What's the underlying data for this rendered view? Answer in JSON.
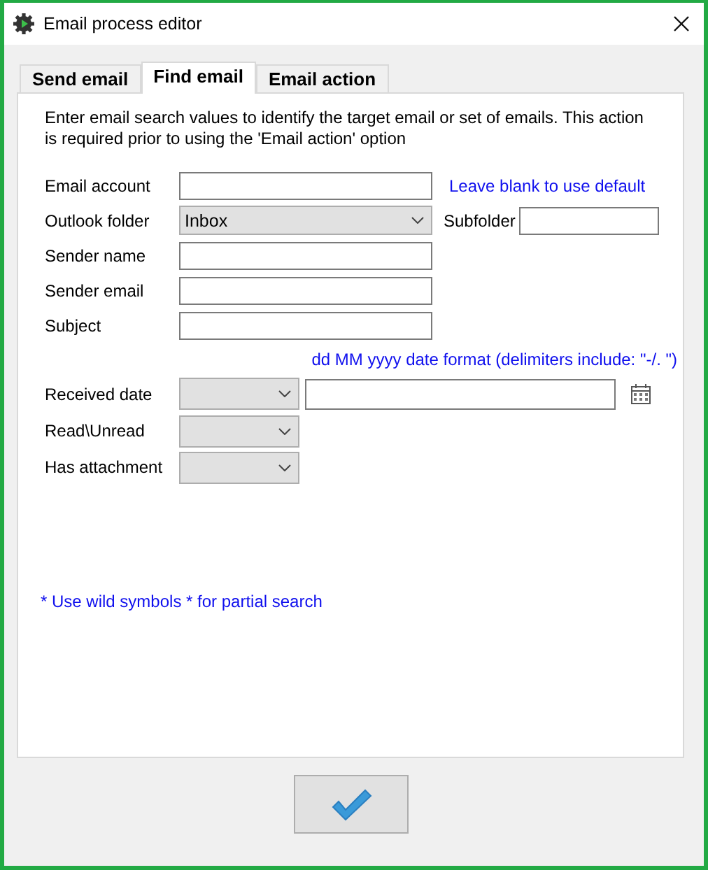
{
  "window": {
    "title": "Email process editor"
  },
  "tabs": [
    {
      "label": "Send email",
      "selected": false
    },
    {
      "label": "Find email",
      "selected": true
    },
    {
      "label": "Email action",
      "selected": false
    }
  ],
  "description": "Enter email search values to identify the target email or set of emails. This action is required prior to using the 'Email action' option",
  "fields": [
    {
      "kind": "text",
      "label": "Email account",
      "hint": "Leave blank to use default"
    },
    {
      "kind": "select",
      "label": "Outlook folder",
      "value": "Inbox",
      "extra_label": "Subfolder"
    },
    {
      "kind": "text",
      "label": "Sender name"
    },
    {
      "kind": "text",
      "label": "Sender email"
    },
    {
      "kind": "text",
      "label": "Subject"
    },
    {
      "kind": "note",
      "text": "dd MM yyyy date format (delimiters include: \"-/. \")"
    },
    {
      "kind": "date",
      "label": "Received date"
    },
    {
      "kind": "small-select",
      "label": "Read\\Unread"
    },
    {
      "kind": "small-select",
      "label": "Has attachment"
    }
  ],
  "footnote": "* Use wild symbols * for partial search"
}
